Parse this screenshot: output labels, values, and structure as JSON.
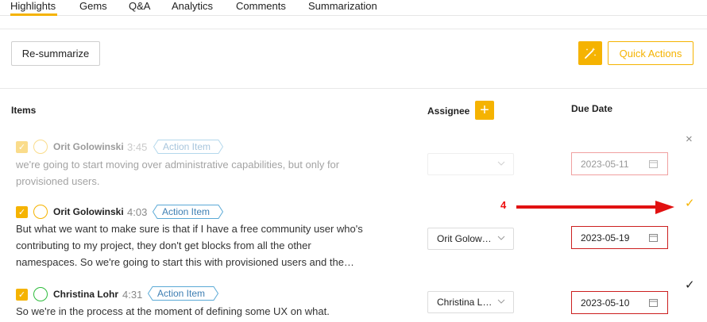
{
  "tabs": [
    "Highlights",
    "Gems",
    "Q&A",
    "Analytics",
    "Comments",
    "Summarization"
  ],
  "toolbar": {
    "resummarize_label": "Re-summarize",
    "wand_icon": "magic-wand-icon",
    "quick_actions_label": "Quick Actions"
  },
  "table": {
    "items_header": "Items",
    "assignee_header": "Assignee",
    "add_assignee": "+",
    "due_date_header": "Due Date"
  },
  "rows": [
    {
      "speaker": "Orit Golowinski",
      "time": "3:45",
      "tag": "Action Item",
      "text": "we're going to start moving over administrative capabilities, but only for provisioned users.",
      "assignee": "",
      "due_date": "2023-05-11",
      "side_icon": "×",
      "status": "dismissed"
    },
    {
      "speaker": "Orit Golowinski",
      "time": "4:03",
      "tag": "Action Item",
      "text": "But what we want to make sure is that if I have a free community user who's contributing to my project, they don't get blocks from all the other namespaces. So we're going to start this with provisioned users and the…",
      "assignee": "Orit Golow…",
      "due_date": "2023-05-19",
      "side_icon": "✓",
      "status": "active"
    },
    {
      "speaker": "Christina Lohr",
      "time": "4:31",
      "tag": "Action Item",
      "text": "So we're in the process at the moment of defining some UX on what.",
      "assignee": "Christina L…",
      "due_date": "2023-05-10",
      "side_icon": "✓",
      "status": "active"
    }
  ],
  "annotation": {
    "label": "4"
  },
  "colors": {
    "accent": "#f5b301",
    "error": "#cc1f1f",
    "annotation": "#e11111",
    "tag": "#5aa9d6"
  }
}
